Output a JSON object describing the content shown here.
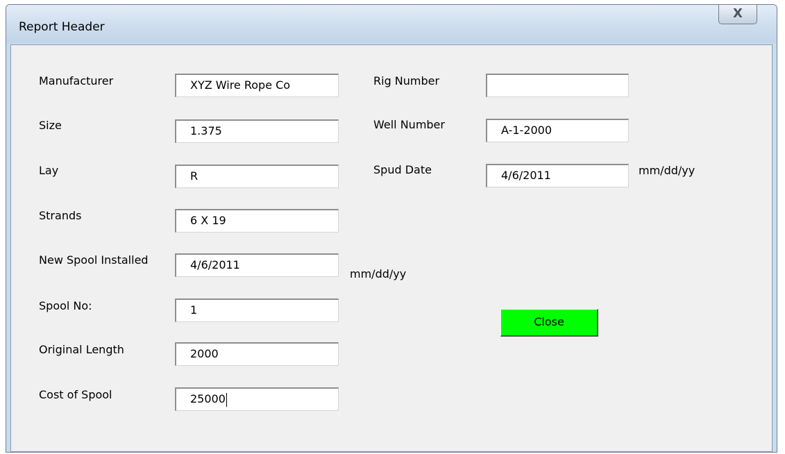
{
  "window": {
    "title": "Report Header",
    "close_glyph": "X"
  },
  "fields": {
    "manufacturer": {
      "label": "Manufacturer",
      "value": "XYZ  Wire Rope Co"
    },
    "size": {
      "label": "Size",
      "value": "1.375"
    },
    "lay": {
      "label": "Lay",
      "value": "R"
    },
    "strands": {
      "label": "Strands",
      "value": "6 X 19"
    },
    "new_spool_installed": {
      "label": "New Spool Installed",
      "value": "4/6/2011",
      "hint": "mm/dd/yy"
    },
    "spool_no": {
      "label": "Spool No:",
      "value": "1"
    },
    "original_length": {
      "label": "Original Length",
      "value": "2000"
    },
    "cost_of_spool": {
      "label": "Cost of Spool",
      "value": "25000"
    },
    "rig_number": {
      "label": "Rig Number",
      "value": ""
    },
    "well_number": {
      "label": "Well Number",
      "value": "A-1-2000"
    },
    "spud_date": {
      "label": "Spud Date",
      "value": "4/6/2011",
      "hint": "mm/dd/yy"
    }
  },
  "buttons": {
    "close_label": "Close",
    "close_color": "#00ff00"
  }
}
